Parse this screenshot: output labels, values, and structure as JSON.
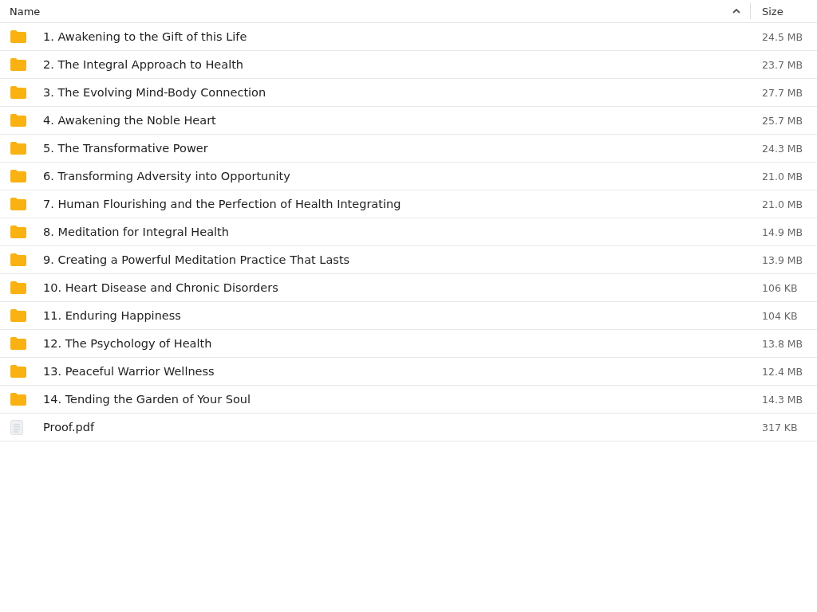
{
  "table": {
    "columns": [
      {
        "label": "Name",
        "sorted": true
      },
      {
        "label": "Size",
        "sorted": false
      }
    ],
    "rows": [
      {
        "kind": "folder",
        "name": "1. Awakening to the Gift of this Life",
        "size": "24.5 MB"
      },
      {
        "kind": "folder",
        "name": "2. The Integral Approach to Health",
        "size": "23.7 MB"
      },
      {
        "kind": "folder",
        "name": "3. The Evolving Mind-Body Connection",
        "size": "27.7 MB"
      },
      {
        "kind": "folder",
        "name": "4. Awakening the Noble Heart",
        "size": "25.7 MB"
      },
      {
        "kind": "folder",
        "name": "5. The Transformative Power",
        "size": "24.3 MB"
      },
      {
        "kind": "folder",
        "name": "6. Transforming Adversity into Opportunity",
        "size": "21.0 MB"
      },
      {
        "kind": "folder",
        "name": "7. Human Flourishing and the Perfection of Health Integrating",
        "size": "21.0 MB"
      },
      {
        "kind": "folder",
        "name": "8. Meditation for Integral Health",
        "size": "14.9 MB"
      },
      {
        "kind": "folder",
        "name": "9. Creating a Powerful Meditation Practice That Lasts",
        "size": "13.9 MB"
      },
      {
        "kind": "folder",
        "name": "10. Heart Disease and Chronic Disorders",
        "size": "106 KB"
      },
      {
        "kind": "folder",
        "name": "11. Enduring Happiness",
        "size": "104 KB"
      },
      {
        "kind": "folder",
        "name": "12. The Psychology of Health",
        "size": "13.8 MB"
      },
      {
        "kind": "folder",
        "name": "13. Peaceful Warrior Wellness",
        "size": "12.4 MB"
      },
      {
        "kind": "folder",
        "name": "14. Tending the Garden of Your Soul",
        "size": "14.3 MB"
      },
      {
        "kind": "file",
        "name": "Proof.pdf",
        "size": "317 KB"
      }
    ]
  }
}
